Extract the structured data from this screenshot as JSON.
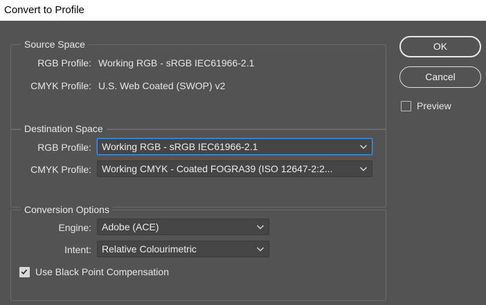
{
  "window": {
    "title": "Convert to Profile"
  },
  "source_space": {
    "legend": "Source Space",
    "rgb_label": "RGB Profile:",
    "rgb_value": "Working RGB - sRGB IEC61966-2.1",
    "cmyk_label": "CMYK Profile:",
    "cmyk_value": "U.S. Web Coated (SWOP) v2"
  },
  "destination_space": {
    "legend": "Destination Space",
    "rgb_label": "RGB Profile:",
    "rgb_selected": "Working RGB - sRGB IEC61966-2.1",
    "cmyk_label": "CMYK Profile:",
    "cmyk_selected": "Working CMYK - Coated FOGRA39 (ISO 12647-2:2..."
  },
  "conversion_options": {
    "legend": "Conversion Options",
    "engine_label": "Engine:",
    "engine_selected": "Adobe (ACE)",
    "intent_label": "Intent:",
    "intent_selected": "Relative Colourimetric",
    "black_point_label": "Use Black Point Compensation",
    "black_point_checked": true
  },
  "buttons": {
    "ok": "OK",
    "cancel": "Cancel"
  },
  "preview": {
    "label": "Preview",
    "checked": false
  },
  "colors": {
    "dialog_bg": "#535353",
    "field_bg": "#454545",
    "focus_accent": "#4b8fd6"
  }
}
